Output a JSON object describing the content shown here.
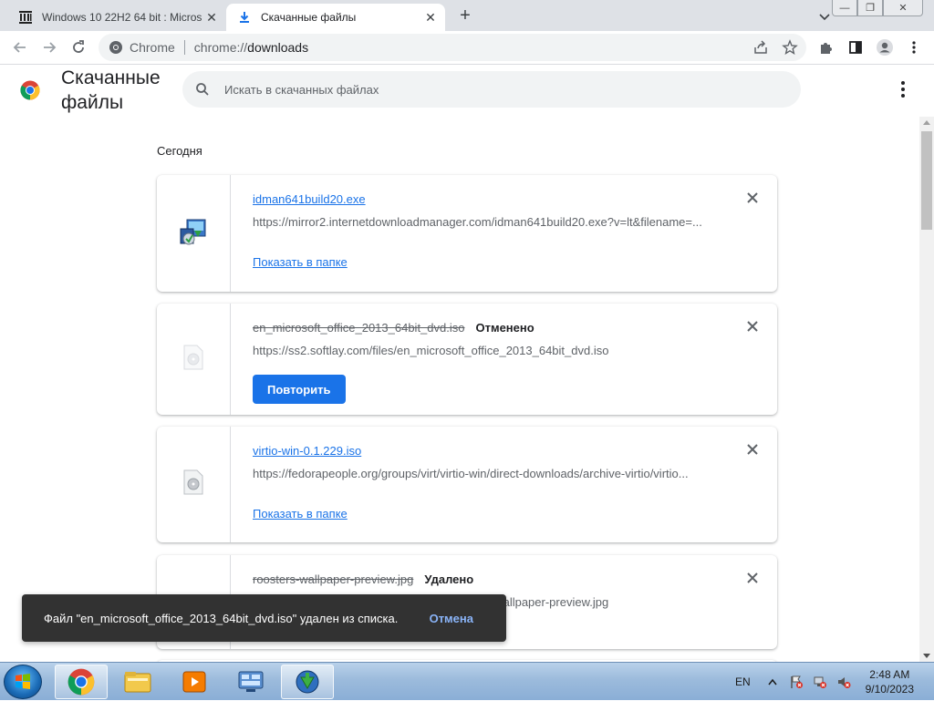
{
  "tabs": [
    {
      "title": "Windows 10 22H2 64 bit : Micros",
      "active": false
    },
    {
      "title": "Скачанные файлы",
      "active": true
    }
  ],
  "window_controls": {
    "minimize": "—",
    "maximize": "❐",
    "close": "✕"
  },
  "toolbar": {
    "site_chip": "Chrome",
    "url_scheme": "chrome://",
    "url_host": "downloads"
  },
  "header": {
    "title": "Скачанные файлы",
    "search_placeholder": "Искать в скачанных файлах"
  },
  "date_group": "Сегодня",
  "downloads": [
    {
      "filename": "idman641build20.exe",
      "status": "",
      "url": "https://mirror2.internetdownloadmanager.com/idman641build20.exe?v=lt&filename=...",
      "action": "Показать в папке",
      "action_type": "link"
    },
    {
      "filename": "en_microsoft_office_2013_64bit_dvd.iso",
      "status": "Отменено",
      "url": "https://ss2.softlay.com/files/en_microsoft_office_2013_64bit_dvd.iso",
      "action": "Повторить",
      "action_type": "button"
    },
    {
      "filename": "virtio-win-0.1.229.iso",
      "status": "",
      "url": "https://fedorapeople.org/groups/virt/virtio-win/direct-downloads/archive-virtio/virtio...",
      "action": "Показать в папке",
      "action_type": "link"
    },
    {
      "filename": "roosters-wallpaper-preview.jpg",
      "status": "Удалено",
      "url": "/948/roosters-wallpaper-preview.jpg",
      "action": "",
      "action_type": "none"
    }
  ],
  "toast": {
    "message": "Файл \"en_microsoft_office_2013_64bit_dvd.iso\" удален из списка.",
    "undo": "Отмена"
  },
  "taskbar": {
    "items": [
      "chrome-app",
      "explorer-app",
      "media-player-app",
      "control-panel-app",
      "idm-app"
    ],
    "tray": {
      "lang": "EN",
      "time": "2:48 AM",
      "date": "9/10/2023"
    }
  },
  "colors": {
    "accent": "#1a73e8",
    "toast_bg": "#323232",
    "tabbar_bg": "#dee1e6"
  }
}
